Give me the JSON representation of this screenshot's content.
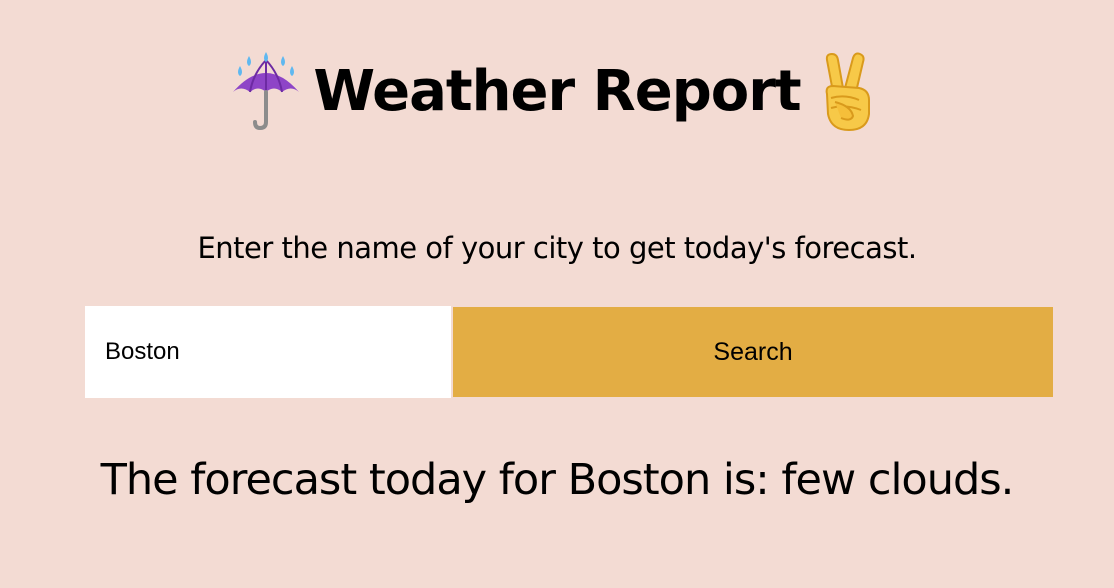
{
  "header": {
    "title": "Weather Report",
    "left_icon": "umbrella-with-rain-drops-icon",
    "right_icon": "victory-hand-icon"
  },
  "instructions": "Enter the name of your city to get today's forecast.",
  "search": {
    "value": "Boston",
    "button_label": "Search"
  },
  "result": "The forecast today for Boston is: few clouds.",
  "colors": {
    "background": "#f3dbd3",
    "button": "#e3ad44",
    "input": "#ffffff"
  }
}
